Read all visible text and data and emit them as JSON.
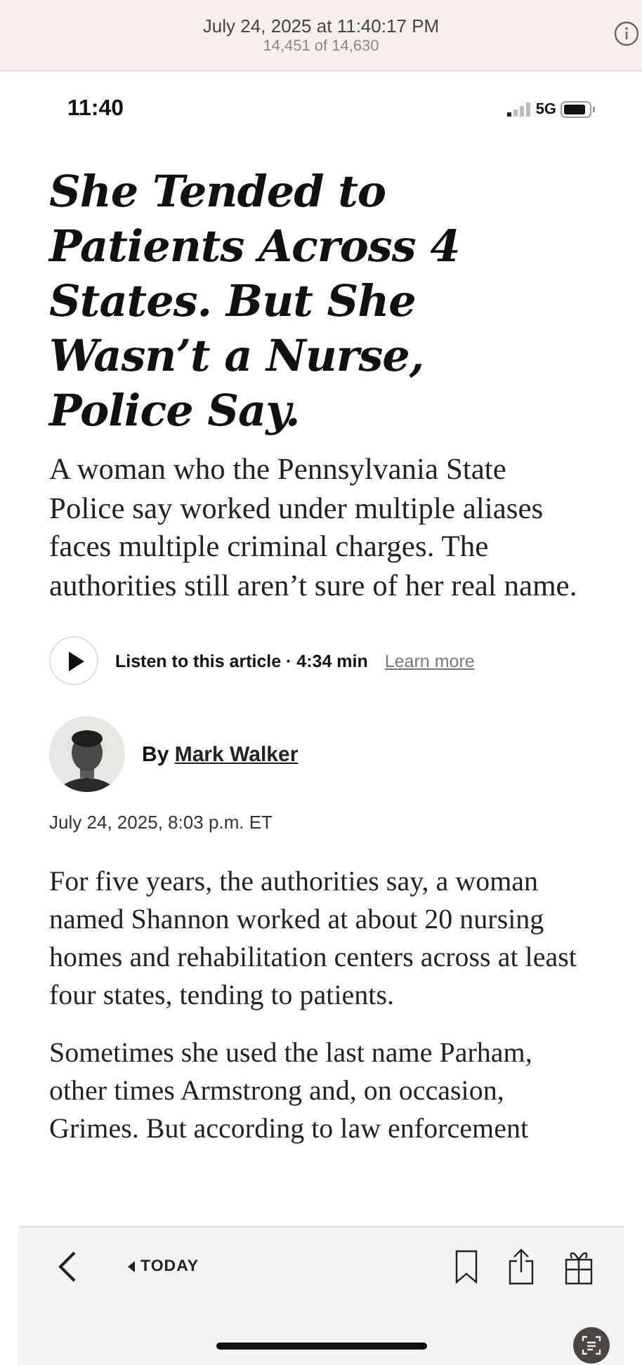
{
  "viewer_header": {
    "timestamp": "July 24, 2025 at 11:40:17 PM",
    "counter": "14,451 of 14,630"
  },
  "status_bar": {
    "time": "11:40",
    "network": "5G"
  },
  "article": {
    "headline": "She Tended to Patients Across 4 States. But She Wasn’t a Nurse, Police Say.",
    "summary": "A woman who the Pennsylvania State Police say worked under multiple aliases faces multiple criminal charges. The authorities still aren’t sure of her real name.",
    "listen": {
      "label": "Listen to this article · 4:34 min",
      "link": "Learn more"
    },
    "byline": {
      "prefix": "By",
      "author": "Mark Walker"
    },
    "dateline": "July 24, 2025, 8:03 p.m. ET",
    "paragraphs": [
      "For five years, the authorities say, a woman named Shannon worked at about 20 nursing homes and rehabilitation centers across at least four states, tending to patients.",
      "Sometimes she used the last name Parham, other times Armstrong and, on occasion, Grimes. But according to law enforcement"
    ]
  },
  "toolbar": {
    "section_link": "TODAY"
  }
}
